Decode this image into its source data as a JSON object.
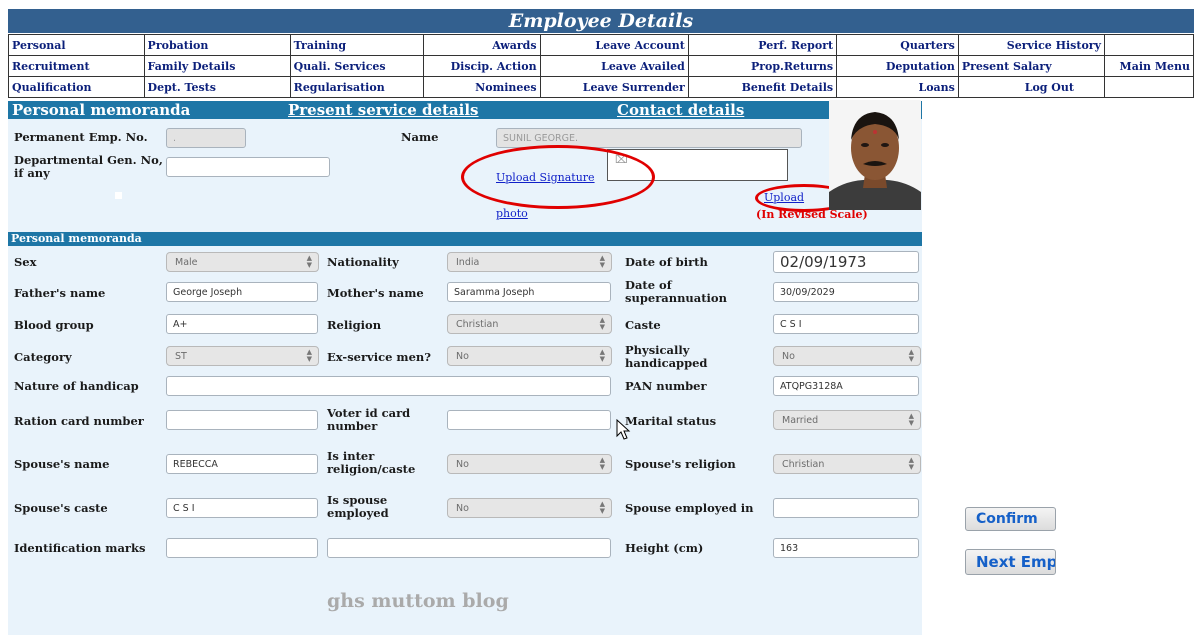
{
  "title": "Employee Details",
  "menu": [
    [
      "Personal",
      "Probation",
      "Training",
      "Awards",
      "Leave Account",
      "Perf. Report",
      "Quarters",
      "Service History"
    ],
    [
      "Recruitment",
      "Family Details",
      "Quali. Services",
      "Discip. Action",
      "Leave Availed",
      "Prop.Returns",
      "Deputation",
      "Present Salary",
      "Main Menu"
    ],
    [
      "Qualification",
      "Dept. Tests",
      "Regularisation",
      "Nominees",
      "Leave Surrender",
      "Benefit Details",
      "Loans",
      "Log Out"
    ]
  ],
  "tabs": {
    "personal": "Personal memoranda",
    "service": "Present service details",
    "contact": "Contact details"
  },
  "top": {
    "emp_no_label": "Permanent Emp. No.",
    "emp_no_value": ".",
    "dept_gen_label": "Departmental Gen. No, if any",
    "dept_gen_value": "",
    "name_label": "Name",
    "name_value": "SUNIL GEORGE.",
    "upload_signature": "Upload Signature",
    "photo_link": "photo",
    "upload_photo": "Upload",
    "revised_scale": "(In Revised Scale)"
  },
  "section_title": "Personal memoranda",
  "fields": {
    "sex": {
      "label": "Sex",
      "value": "Male"
    },
    "nationality": {
      "label": "Nationality",
      "value": "India"
    },
    "dob": {
      "label": "Date of birth",
      "value": "02/09/1973"
    },
    "father": {
      "label": "Father's name",
      "value": "George Joseph"
    },
    "mother": {
      "label": "Mother's name",
      "value": "Saramma Joseph"
    },
    "superannuation": {
      "label": "Date of superannuation",
      "value": "30/09/2029"
    },
    "blood": {
      "label": "Blood group",
      "value": "A+"
    },
    "religion": {
      "label": "Religion",
      "value": "Christian"
    },
    "caste": {
      "label": "Caste",
      "value": "C S I"
    },
    "category": {
      "label": "Category",
      "value": "ST"
    },
    "ex_service": {
      "label": "Ex-service men?",
      "value": "No"
    },
    "physically": {
      "label": "Physically handicapped",
      "value": "No"
    },
    "handicap": {
      "label": "Nature of handicap",
      "value": ""
    },
    "pan": {
      "label": "PAN number",
      "value": "ATQPG3128A"
    },
    "ration": {
      "label": "Ration card number",
      "value": ""
    },
    "voter": {
      "label": "Voter id card number",
      "value": ""
    },
    "marital": {
      "label": "Marital status",
      "value": "Married"
    },
    "spouse_name": {
      "label": "Spouse's name",
      "value": "REBECCA"
    },
    "inter": {
      "label": "Is inter religion/caste",
      "value": "No"
    },
    "spouse_religion": {
      "label": "Spouse's religion",
      "value": "Christian"
    },
    "spouse_caste": {
      "label": "Spouse's caste",
      "value": "C S I"
    },
    "spouse_employed": {
      "label": "Is spouse employed",
      "value": "No"
    },
    "spouse_emp_in": {
      "label": "Spouse employed in",
      "value": ""
    },
    "id_marks": {
      "label": "Identification marks",
      "value1": "",
      "value2": ""
    },
    "height": {
      "label": "Height (cm)",
      "value": "163"
    }
  },
  "buttons": {
    "confirm": "Confirm",
    "next": "Next Emp"
  },
  "watermark": "ghs muttom blog",
  "colors": {
    "title_bar": "#33608f",
    "header_bar": "#1e76a6",
    "panel_bg": "#e9f3fb",
    "annotation_red": "#e00000"
  }
}
